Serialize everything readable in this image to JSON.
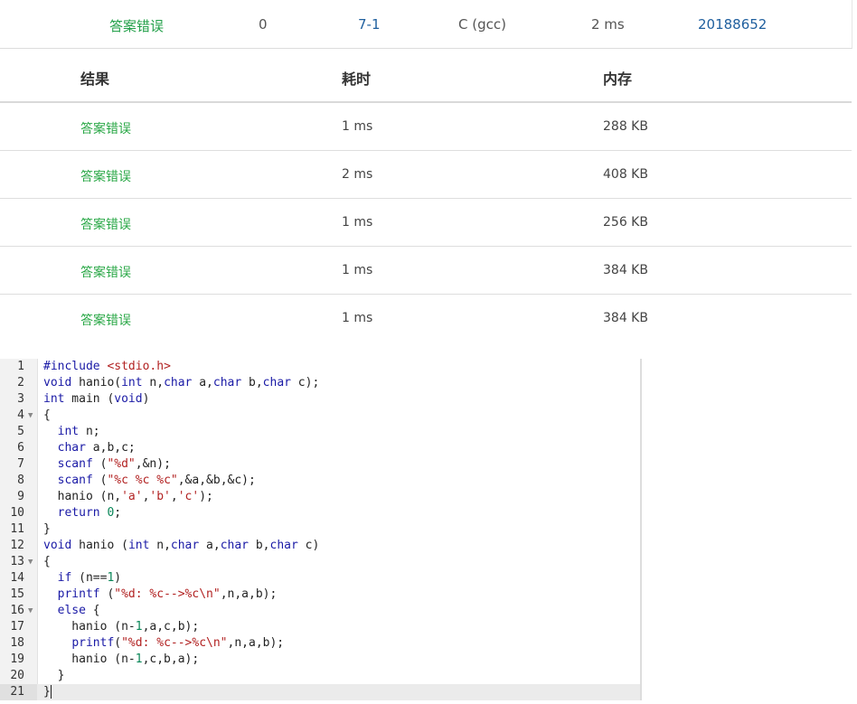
{
  "submission": {
    "status": "答案错误",
    "score": "0",
    "problem": "7-1",
    "compiler": "C (gcc)",
    "time": "2 ms",
    "user": "20188652"
  },
  "results_table": {
    "headers": [
      "结果",
      "耗时",
      "内存"
    ],
    "rows": [
      {
        "result": "答案错误",
        "time": "1 ms",
        "memory": "288 KB"
      },
      {
        "result": "答案错误",
        "time": "2 ms",
        "memory": "408 KB"
      },
      {
        "result": "答案错误",
        "time": "1 ms",
        "memory": "256 KB"
      },
      {
        "result": "答案错误",
        "time": "1 ms",
        "memory": "384 KB"
      },
      {
        "result": "答案错误",
        "time": "1 ms",
        "memory": "384 KB"
      }
    ]
  },
  "code": {
    "lines": [
      "#include <stdio.h>",
      "void hanio(int n,char a,char b,char c);",
      "int main (void)",
      "{",
      "  int n;",
      "  char a,b,c;",
      "  scanf (\"%d\",&n);",
      "  scanf (\"%c %c %c\",&a,&b,&c);",
      "  hanio (n,'a','b','c');",
      "  return 0;",
      "}",
      "void hanio (int n,char a,char b,char c)",
      "{",
      "  if (n==1)",
      "  printf (\"%d: %c-->%c\\n\",n,a,b);",
      "  else {",
      "    hanio (n-1,a,c,b);",
      "    printf(\"%d: %c-->%c\\n\",n,a,b);",
      "    hanio (n-1,c,b,a);",
      "  }",
      "}"
    ],
    "fold_lines": [
      4,
      13,
      16
    ],
    "active_line": 21
  }
}
